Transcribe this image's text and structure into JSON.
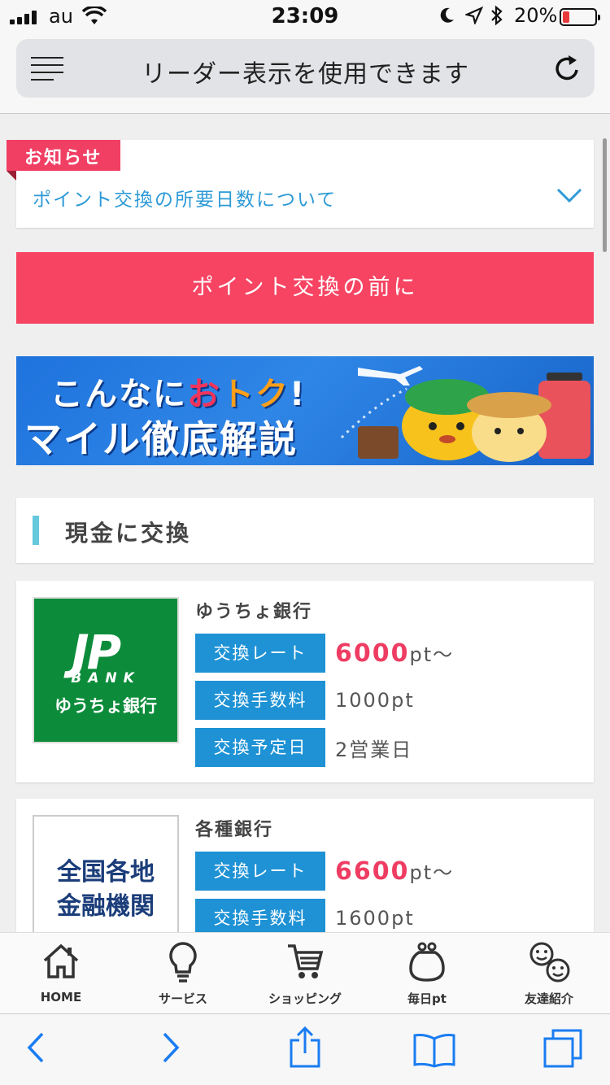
{
  "status": {
    "carrier": "au",
    "time": "23:09",
    "battery": "20%",
    "battery_level": 0.2
  },
  "browser": {
    "reader_text": "リーダー表示を使用できます"
  },
  "notice": {
    "tag": "お知らせ",
    "text": "ポイント交換の所要日数について"
  },
  "before_button": "ポイント交換の前に",
  "banner": {
    "line1_a": "こんなに",
    "line1_b": "お",
    "line1_c": "トク",
    "line1_d": "!",
    "line2": "マイル徹底解説"
  },
  "section": {
    "title": "現金に交換"
  },
  "cards": [
    {
      "logo": {
        "mark": "JP",
        "sub": "BANK",
        "name": "ゆうちょ銀行"
      },
      "name": "ゆうちょ銀行",
      "rows": [
        {
          "label": "交換レート",
          "value_num": "6000",
          "value_unit": "pt〜"
        },
        {
          "label": "交換手数料",
          "value": "1000pt"
        },
        {
          "label": "交換予定日",
          "value": "2営業日"
        }
      ]
    },
    {
      "logo": {
        "line1": "全国各地",
        "line2": "金融機関"
      },
      "name": "各種銀行",
      "rows": [
        {
          "label": "交換レート",
          "value_num": "6600",
          "value_unit": "pt〜"
        },
        {
          "label": "交換手数料",
          "value": "1600pt"
        }
      ]
    }
  ],
  "tabbar": [
    {
      "label": "HOME",
      "icon": "home-icon"
    },
    {
      "label": "サービス",
      "icon": "lightbulb-icon"
    },
    {
      "label": "ショッピング",
      "icon": "cart-icon"
    },
    {
      "label": "毎日pt",
      "icon": "purse-icon"
    },
    {
      "label": "友達紹介",
      "icon": "friends-icon"
    }
  ],
  "colors": {
    "accent_pink": "#f74462",
    "label_blue": "#1e92d5",
    "link_blue": "#2e9ad7",
    "highlight": "#ef3c62"
  }
}
